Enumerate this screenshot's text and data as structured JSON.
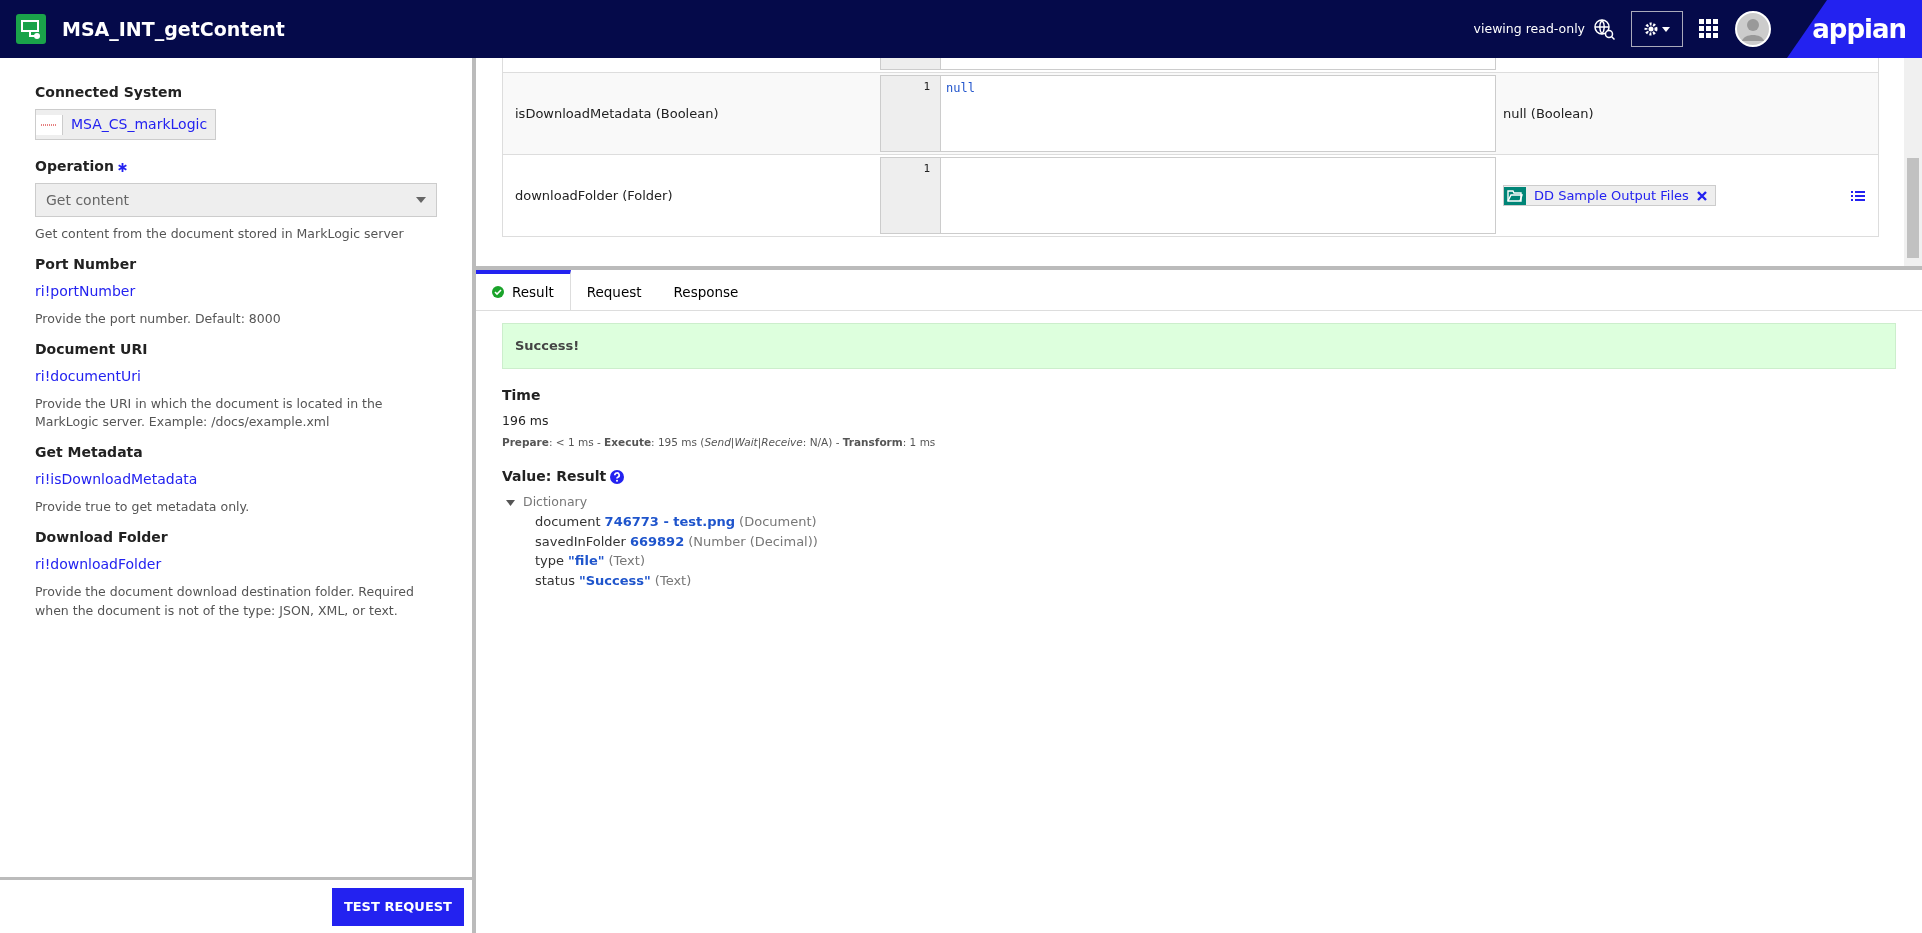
{
  "header": {
    "title": "MSA_INT_getContent",
    "mode": "viewing read-only",
    "logo": "appian"
  },
  "left_panel": {
    "connected_system": {
      "label": "Connected System",
      "value": "MSA_CS_markLogic"
    },
    "operation": {
      "label": "Operation",
      "required": true,
      "value": "Get content",
      "help": "Get content from the document stored in MarkLogic server"
    },
    "parameters": [
      {
        "label": "Port Number",
        "value": "ri!portNumber",
        "help": "Provide the port number. Default: 8000"
      },
      {
        "label": "Document URI",
        "value": "ri!documentUri",
        "help": "Provide the URI in which the document is located in the MarkLogic server. Example: /docs/example.xml"
      },
      {
        "label": "Get Metadata",
        "value": "ri!isDownloadMetadata",
        "help": "Provide true to get metadata only."
      },
      {
        "label": "Download Folder",
        "value": "ri!downloadFolder",
        "help": "Provide the document download destination folder. Required when the document is not of the type: JSON, XML, or text."
      }
    ],
    "test_button": "TEST REQUEST"
  },
  "inputs_table": {
    "rows": [
      {
        "kind": "text",
        "name": "isDownloadMetadata (Boolean)",
        "line": "1",
        "code": "null",
        "result": "null (Boolean)"
      },
      {
        "kind": "folder",
        "name": "downloadFolder (Folder)",
        "line": "1",
        "result": "DD Sample Output Files"
      }
    ]
  },
  "tabs": [
    {
      "label": "Result",
      "selected": true
    },
    {
      "label": "Request",
      "selected": false
    },
    {
      "label": "Response",
      "selected": false
    }
  ],
  "result": {
    "banner": "Success!",
    "time_label": "Time",
    "time": "196 ms",
    "timing": "**Prepare**: < 1 ms - **Execute**: 195 ms (*Send|Wait|Receive*: N/A) - **Transform**: 1 ms",
    "value_label": "Value: Result",
    "tree": {
      "label": "Dictionary",
      "expanded": true,
      "children": [
        {
          "key": "document",
          "value": "746773 - test.png",
          "type": "(Document)"
        },
        {
          "key": "savedInFolder",
          "value": "669892",
          "type": "(Number (Decimal))"
        },
        {
          "key": "type",
          "value": "\"file\"",
          "type": "(Text)"
        },
        {
          "key": "status",
          "value": "\"Success\"",
          "type": "(Text)"
        }
      ]
    }
  }
}
